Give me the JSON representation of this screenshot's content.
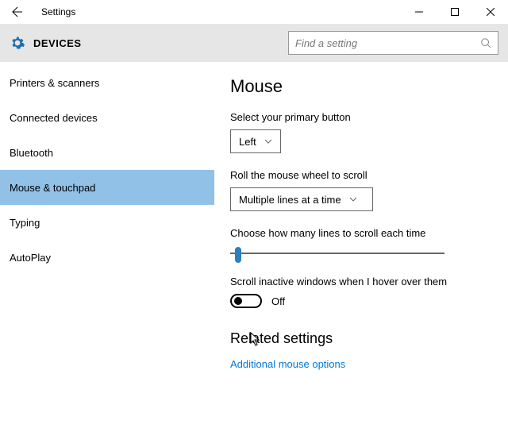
{
  "window": {
    "title": "Settings"
  },
  "header": {
    "label": "DEVICES",
    "search_placeholder": "Find a setting"
  },
  "sidebar": {
    "items": [
      {
        "label": "Printers & scanners"
      },
      {
        "label": "Connected devices"
      },
      {
        "label": "Bluetooth"
      },
      {
        "label": "Mouse & touchpad"
      },
      {
        "label": "Typing"
      },
      {
        "label": "AutoPlay"
      }
    ]
  },
  "main": {
    "title": "Mouse",
    "primary_label": "Select your primary button",
    "primary_value": "Left",
    "scroll_label": "Roll the mouse wheel to scroll",
    "scroll_value": "Multiple lines at a time",
    "lines_label": "Choose how many lines to scroll each time",
    "inactive_label": "Scroll inactive windows when I hover over them",
    "inactive_state": "Off",
    "related_heading": "Related settings",
    "related_link": "Additional mouse options"
  }
}
